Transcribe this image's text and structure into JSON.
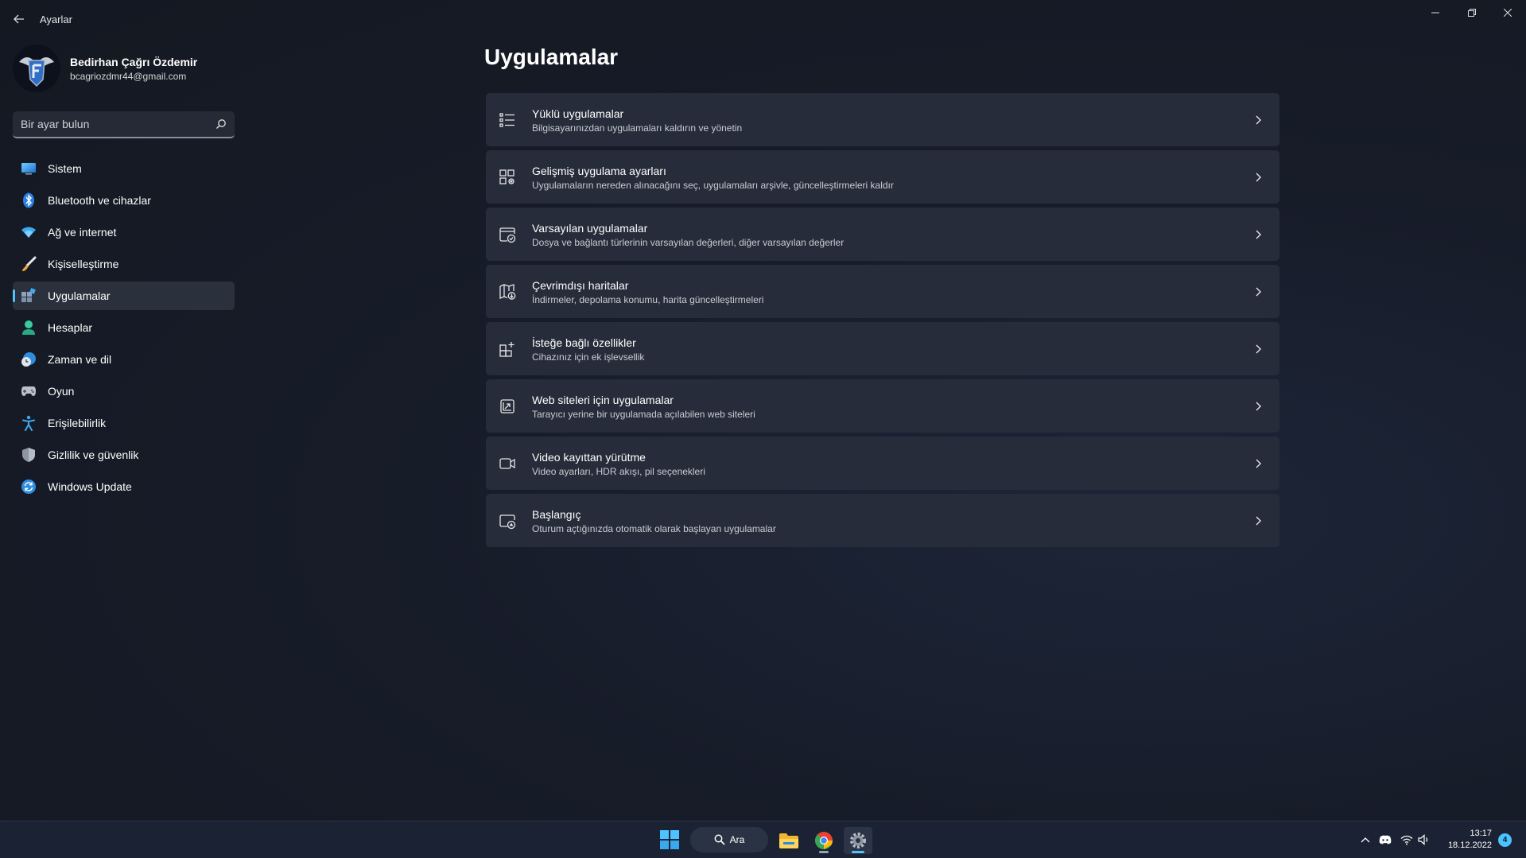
{
  "window": {
    "title": "Ayarlar"
  },
  "profile": {
    "name": "Bedirhan Çağrı Özdemir",
    "email": "bcagriozdmr44@gmail.com"
  },
  "search": {
    "placeholder": "Bir ayar bulun"
  },
  "sidebar": {
    "items": [
      {
        "label": "Sistem",
        "icon": "display-icon"
      },
      {
        "label": "Bluetooth ve cihazlar",
        "icon": "bluetooth-icon"
      },
      {
        "label": "Ağ ve internet",
        "icon": "wifi-icon"
      },
      {
        "label": "Kişiselleştirme",
        "icon": "brush-icon"
      },
      {
        "label": "Uygulamalar",
        "icon": "apps-icon",
        "active": true
      },
      {
        "label": "Hesaplar",
        "icon": "person-icon"
      },
      {
        "label": "Zaman ve dil",
        "icon": "globe-clock-icon"
      },
      {
        "label": "Oyun",
        "icon": "gamepad-icon"
      },
      {
        "label": "Erişilebilirlik",
        "icon": "accessibility-icon"
      },
      {
        "label": "Gizlilik ve güvenlik",
        "icon": "shield-icon"
      },
      {
        "label": "Windows Update",
        "icon": "sync-icon"
      }
    ]
  },
  "main": {
    "title": "Uygulamalar",
    "cards": [
      {
        "title": "Yüklü uygulamalar",
        "desc": "Bilgisayarınızdan uygulamaları kaldırın ve yönetin",
        "icon": "list-icon"
      },
      {
        "title": "Gelişmiş uygulama ayarları",
        "desc": "Uygulamaların nereden alınacağını seç, uygulamaları arşivle, güncelleştirmeleri kaldır",
        "icon": "app-settings-icon"
      },
      {
        "title": "Varsayılan uygulamalar",
        "desc": "Dosya ve bağlantı türlerinin varsayılan değerleri, diğer varsayılan değerler",
        "icon": "default-apps-icon"
      },
      {
        "title": "Çevrimdışı haritalar",
        "desc": "İndirmeler, depolama konumu, harita güncelleştirmeleri",
        "icon": "offline-map-icon"
      },
      {
        "title": "İsteğe bağlı özellikler",
        "desc": "Cihazınız için ek işlevsellik",
        "icon": "optional-features-icon"
      },
      {
        "title": "Web siteleri için uygulamalar",
        "desc": "Tarayıcı yerine bir uygulamada açılabilen web siteleri",
        "icon": "open-external-icon"
      },
      {
        "title": "Video kayıttan yürütme",
        "desc": "Video ayarları, HDR akışı, pil seçenekleri",
        "icon": "video-icon"
      },
      {
        "title": "Başlangıç",
        "desc": "Oturum açtığınızda otomatik olarak başlayan uygulamalar",
        "icon": "startup-icon"
      }
    ]
  },
  "taskbar": {
    "search_label": "Ara",
    "time": "13:17",
    "date": "18.12.2022",
    "notification_count": "4"
  },
  "colors": {
    "accent": "#4cc2ff",
    "card_bg": "#262c39",
    "window_bg": "#171c29"
  }
}
